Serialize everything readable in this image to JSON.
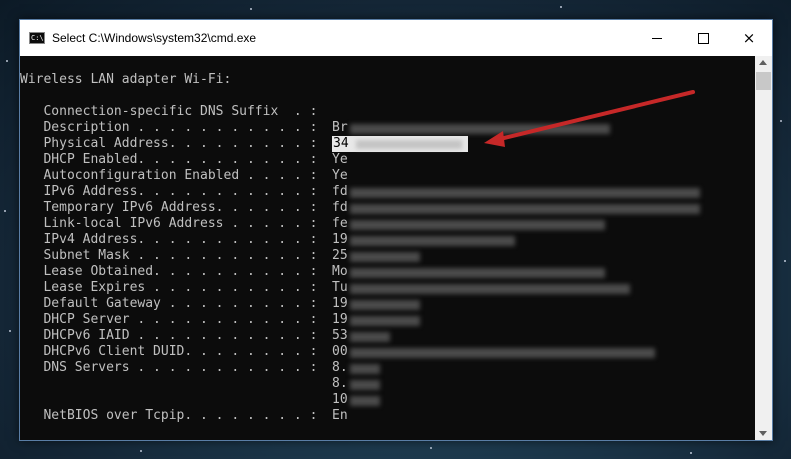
{
  "window": {
    "title": "Select C:\\Windows\\system32\\cmd.exe",
    "icon_text": "C:\\"
  },
  "controls": {
    "minimize": "minimize-icon",
    "maximize": "maximize-icon",
    "close": "×"
  },
  "console": {
    "header": "Wireless LAN adapter Wi-Fi:",
    "lines": [
      {
        "label": "   Connection-specific DNS Suffix  . :",
        "value": ""
      },
      {
        "label": "   Description . . . . . . . . . . . :",
        "value": "Br"
      },
      {
        "label": "   Physical Address. . . . . . . . . :",
        "value": "34"
      },
      {
        "label": "   DHCP Enabled. . . . . . . . . . . :",
        "value": "Ye"
      },
      {
        "label": "   Autoconfiguration Enabled . . . . :",
        "value": "Ye"
      },
      {
        "label": "   IPv6 Address. . . . . . . . . . . :",
        "value": "fd"
      },
      {
        "label": "   Temporary IPv6 Address. . . . . . :",
        "value": "fd"
      },
      {
        "label": "   Link-local IPv6 Address . . . . . :",
        "value": "fe"
      },
      {
        "label": "   IPv4 Address. . . . . . . . . . . :",
        "value": "19"
      },
      {
        "label": "   Subnet Mask . . . . . . . . . . . :",
        "value": "25"
      },
      {
        "label": "   Lease Obtained. . . . . . . . . . :",
        "value": "Mo"
      },
      {
        "label": "   Lease Expires . . . . . . . . . . :",
        "value": "Tu"
      },
      {
        "label": "   Default Gateway . . . . . . . . . :",
        "value": "19"
      },
      {
        "label": "   DHCP Server . . . . . . . . . . . :",
        "value": "19"
      },
      {
        "label": "   DHCPv6 IAID . . . . . . . . . . . :",
        "value": "53"
      },
      {
        "label": "   DHCPv6 Client DUID. . . . . . . . :",
        "value": "00"
      },
      {
        "label": "   DNS Servers . . . . . . . . . . . :",
        "value": "8."
      },
      {
        "label": "",
        "value": "8."
      },
      {
        "label": "",
        "value": "10"
      },
      {
        "label": "   NetBIOS over Tcpip. . . . . . . . :",
        "value": "En"
      }
    ]
  },
  "annotation": {
    "arrow_color": "#c62828"
  }
}
